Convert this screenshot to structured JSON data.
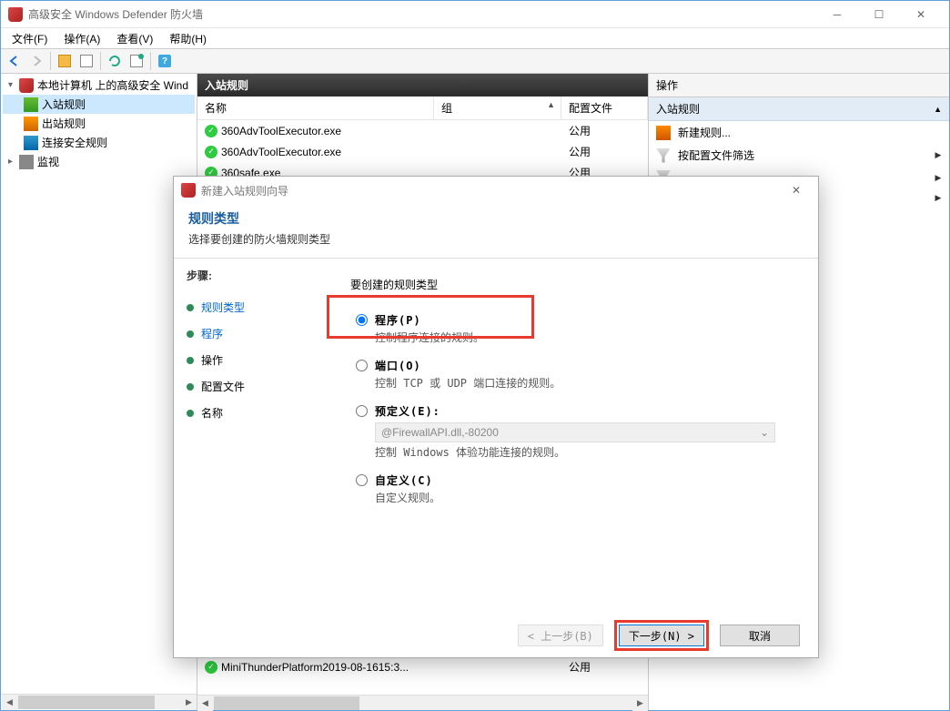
{
  "window": {
    "title": "高级安全 Windows Defender 防火墙"
  },
  "menus": {
    "file": "文件(F)",
    "action": "操作(A)",
    "view": "查看(V)",
    "help": "帮助(H)"
  },
  "tree": {
    "root": "本地计算机 上的高级安全 Wind",
    "inbound": "入站规则",
    "outbound": "出站规则",
    "connsec": "连接安全规则",
    "monitor": "监视"
  },
  "list": {
    "title": "入站规则",
    "cols": {
      "name": "名称",
      "group": "组",
      "profile": "配置文件"
    },
    "rows": [
      {
        "name": "360AdvToolExecutor.exe",
        "profile": "公用"
      },
      {
        "name": "360AdvToolExecutor.exe",
        "profile": "公用"
      },
      {
        "name": "360safe.exe",
        "profile": "公用"
      }
    ],
    "bottom_row": {
      "name": "MiniThunderPlatform2019-08-1615:3...",
      "profile": "公用"
    }
  },
  "actions": {
    "header": "操作",
    "section": "入站规则",
    "new_rule": "新建规则...",
    "filter_profile": "按配置文件筛选"
  },
  "dialog": {
    "title": "新建入站规则向导",
    "heading": "规则类型",
    "subheading": "选择要创建的防火墙规则类型",
    "steps_label": "步骤:",
    "steps": {
      "type": "规则类型",
      "program": "程序",
      "action": "操作",
      "profile": "配置文件",
      "name": "名称"
    },
    "form_title": "要创建的规则类型",
    "options": {
      "program": {
        "label": "程序(P)",
        "desc": "控制程序连接的规则。"
      },
      "port": {
        "label": "端口(O)",
        "desc": "控制 TCP 或 UDP 端口连接的规则。"
      },
      "predefined": {
        "label": "预定义(E):",
        "combo": "@FirewallAPI.dll,-80200",
        "desc": "控制 Windows 体验功能连接的规则。"
      },
      "custom": {
        "label": "自定义(C)",
        "desc": "自定义规则。"
      }
    },
    "buttons": {
      "back": "< 上一步(B)",
      "next": "下一步(N) >",
      "cancel": "取消"
    }
  }
}
